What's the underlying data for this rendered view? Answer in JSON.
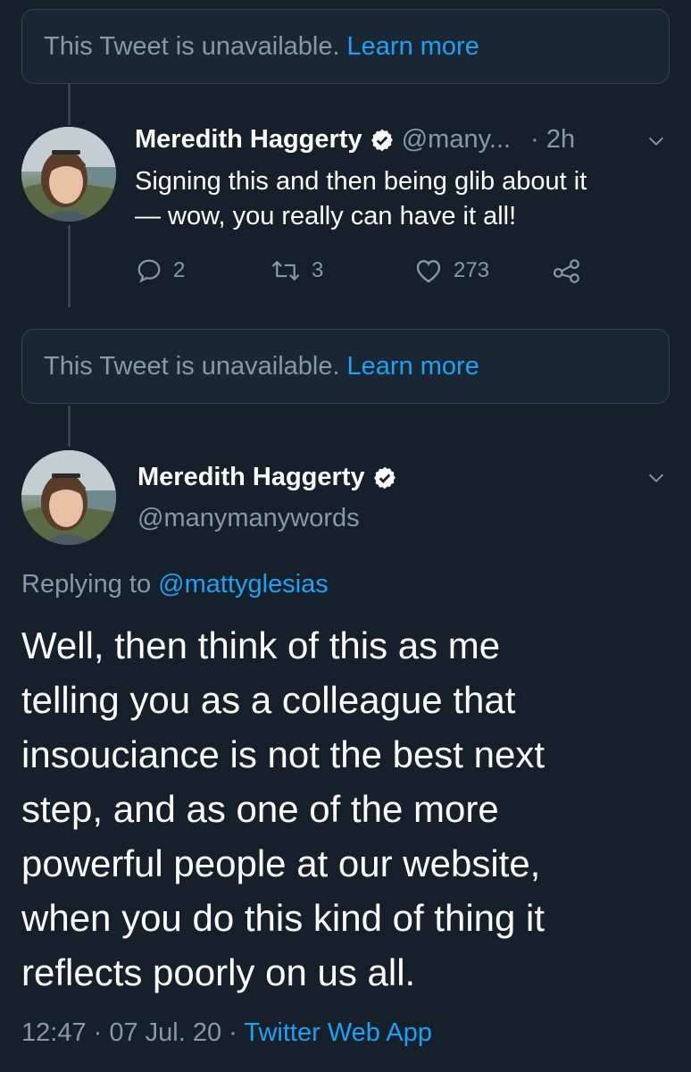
{
  "unavailable1": {
    "text": "This Tweet is unavailable.",
    "link": "Learn more"
  },
  "tweet1": {
    "name": "Meredith Haggerty",
    "handle": "@many...",
    "time": "· 2h",
    "text_line1": "Signing this and then being glib about it",
    "text_line2": "— wow, you really can have it all!",
    "replies": "2",
    "retweets": "3",
    "likes": "273"
  },
  "unavailable2": {
    "text": "This Tweet is unavailable.",
    "link": "Learn more"
  },
  "tweet2": {
    "name": "Meredith Haggerty",
    "handle": "@manymanywords",
    "replying_prefix": "Replying to",
    "replying_to": "@mattyglesias",
    "text_lines": [
      "Well, then think of this as me",
      "telling you as a colleague that",
      "insouciance is not the best next",
      "step, and as one of the more",
      "powerful people at our website,",
      "when you do this kind of thing it",
      "reflects poorly on us all."
    ],
    "timestamp": "12:47 · 07 Jul. 20 ·",
    "source": "Twitter Web App"
  },
  "colors": {
    "background": "#15202b",
    "accent": "#1da1f2",
    "muted": "#8899a6",
    "border": "#38444d"
  },
  "icons": [
    "verified-badge-icon",
    "chevron-down-icon",
    "reply-icon",
    "retweet-icon",
    "like-icon",
    "share-icon"
  ]
}
